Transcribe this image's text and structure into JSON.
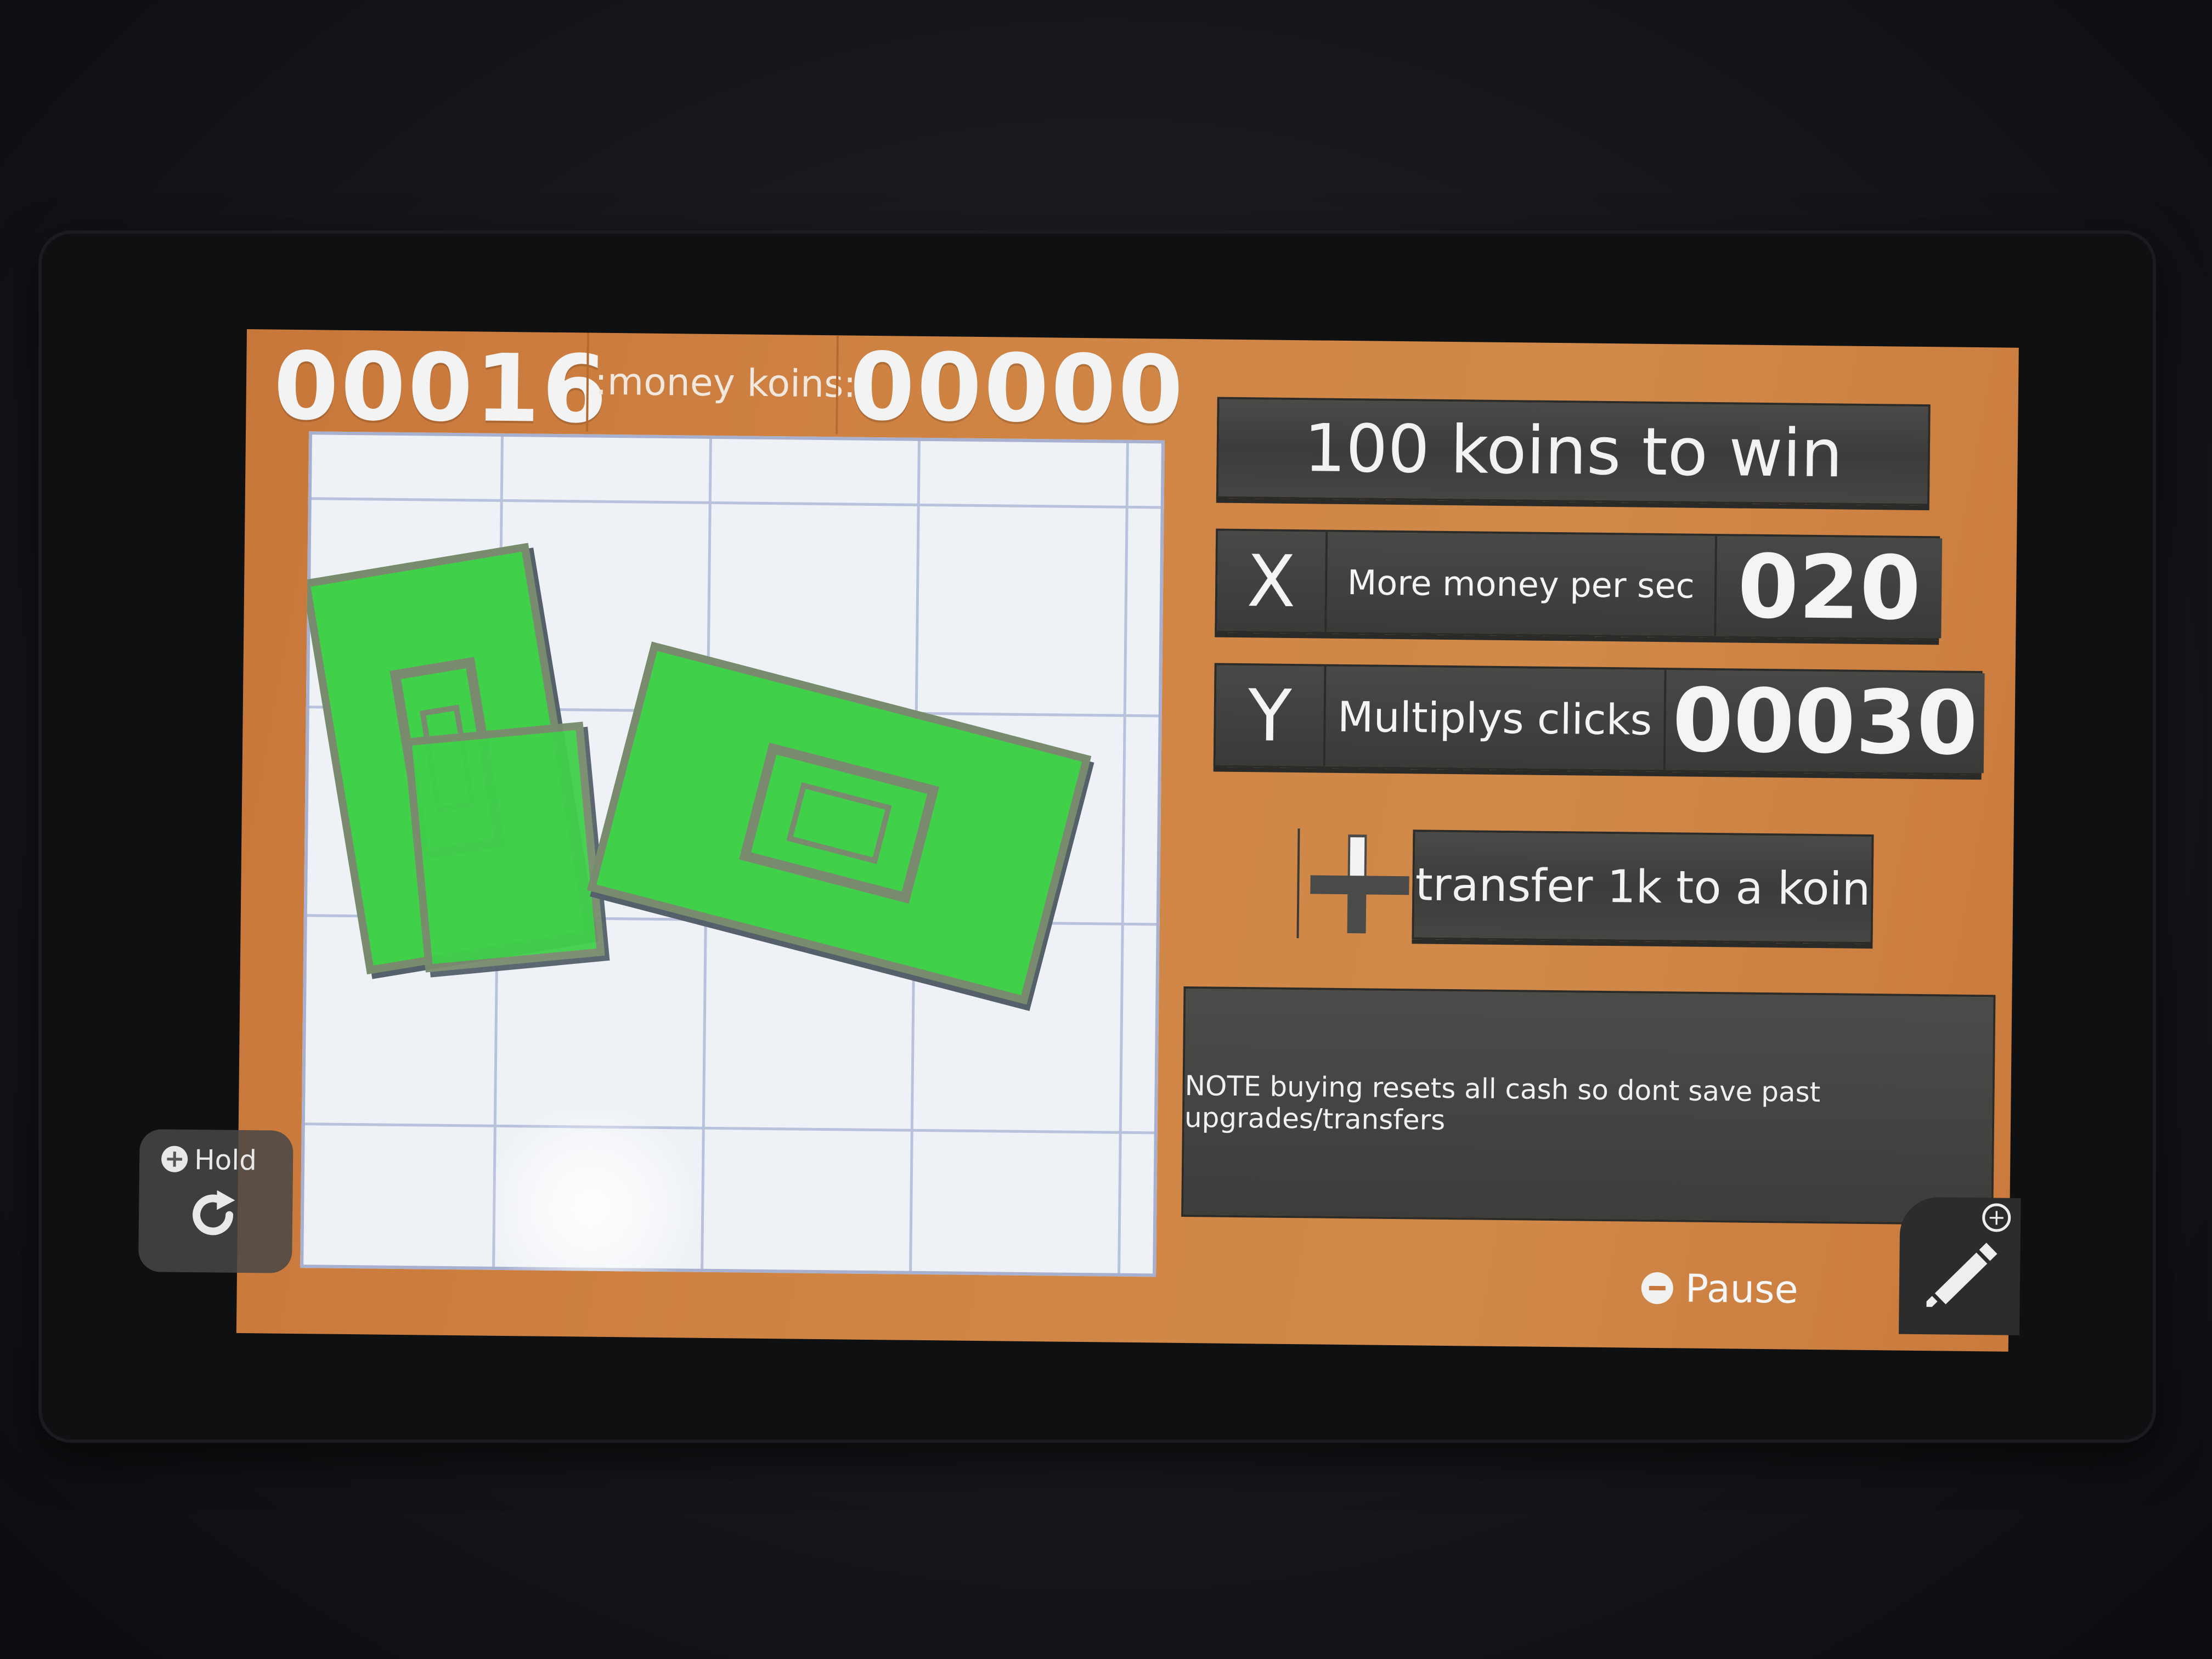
{
  "hud": {
    "score": "00016",
    "koins_label": ":money koins:",
    "koins": "00000"
  },
  "panels": {
    "goal": "100 koins to win",
    "upgrade_money": {
      "button": "X",
      "label": "More money per sec",
      "value": "020"
    },
    "upgrade_clicks": {
      "button": "Y",
      "label": "Multiplys clicks",
      "value": "00030"
    },
    "transfer": {
      "button": "+",
      "label": "transfer 1k to a koin"
    },
    "note": "NOTE buying resets all cash so dont save past upgrades/transfers"
  },
  "controls": {
    "hold_label": "Hold",
    "pause_label": "Pause"
  },
  "colors": {
    "background_wood": "#cf8444",
    "bill_green": "#40d04a",
    "panel_dark": "#434341"
  },
  "icons": [
    "plus-circle-icon",
    "rotate-icon",
    "minus-circle-icon",
    "pencil-icon",
    "dpad-plus-icon"
  ]
}
